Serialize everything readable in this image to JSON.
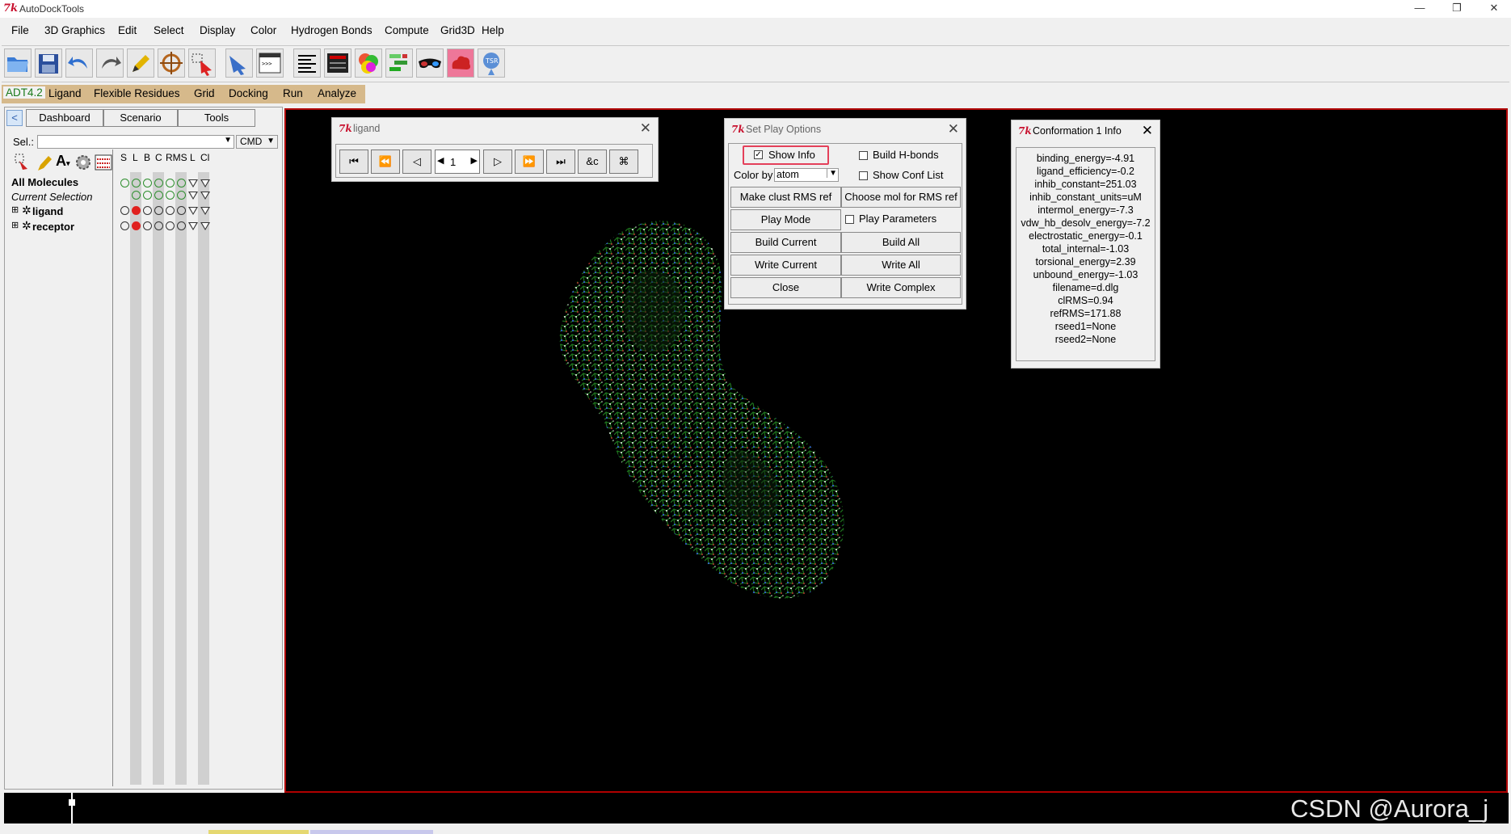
{
  "window": {
    "title": "AutoDockTools",
    "minimize": "—",
    "restore": "❐",
    "close": "✕"
  },
  "menu": [
    "File",
    "3D Graphics",
    "Edit",
    "Select",
    "Display",
    "Color",
    "Hydrogen Bonds",
    "Compute",
    "Grid3D",
    "Help"
  ],
  "adt_menu": [
    "ADT4.2",
    "Ligand",
    "Flexible Residues",
    "Grid",
    "Docking",
    "Run",
    "Analyze"
  ],
  "toolbar_icons": [
    "open-folder-icon",
    "save-icon",
    "undo-icon",
    "redo-icon",
    "pencil-icon",
    "target-icon",
    "select-cursor-icon",
    "pointer-hand-icon",
    "python-shell-icon",
    "text-lines-icon",
    "dejavu-gui-icon",
    "color-spheres-icon",
    "molecule-pyramid-icon",
    "stereo-glasses-icon",
    "cloud-red-icon",
    "pmv-about-icon"
  ],
  "left_panel": {
    "tabs": [
      "Dashboard",
      "Scenario",
      "Tools"
    ],
    "sel_label": "Sel.:",
    "cmd_label": "CMD",
    "columns": [
      "S",
      "L",
      "B",
      "C",
      "RMS",
      "L",
      "Cl"
    ],
    "rows": [
      {
        "label": "All Molecules"
      },
      {
        "label": "Current Selection"
      },
      {
        "label": "ligand"
      },
      {
        "label": "receptor"
      }
    ]
  },
  "ligand_dialog": {
    "title": "ligand",
    "frame": "1",
    "buttons": [
      "⏮",
      "⏪",
      "◁",
      "▷",
      "⏩",
      "⏭",
      "&c",
      "⌘"
    ]
  },
  "play_options": {
    "title": "Set Play Options",
    "show_info": "Show Info",
    "build_hbonds": "Build  H-bonds",
    "color_by_label": "Color by",
    "color_by_value": "atom",
    "show_conf_list": "Show Conf List",
    "make_clust_rms": "Make clust RMS ref",
    "choose_mol_rms": "Choose mol for RMS ref",
    "play_mode": "Play Mode",
    "play_parameters": "Play Parameters",
    "build_current": "Build Current",
    "build_all": "Build All",
    "write_current": "Write Current",
    "write_all": "Write All",
    "close": "Close",
    "write_complex": "Write Complex"
  },
  "conformation_info": {
    "title": "Conformation 1 Info",
    "lines": [
      "binding_energy=-4.91",
      "ligand_efficiency=-0.2",
      "inhib_constant=251.03",
      "inhib_constant_units=uM",
      "intermol_energy=-7.3",
      "vdw_hb_desolv_energy=-7.2",
      "electrostatic_energy=-0.1",
      "total_internal=-1.03",
      "torsional_energy=2.39",
      "unbound_energy=-1.03",
      "filename=d.dlg",
      "clRMS=0.94",
      "refRMS=171.88",
      "rseed1=None",
      "rseed2=None"
    ]
  },
  "watermark": "CSDN @Aurora_j"
}
